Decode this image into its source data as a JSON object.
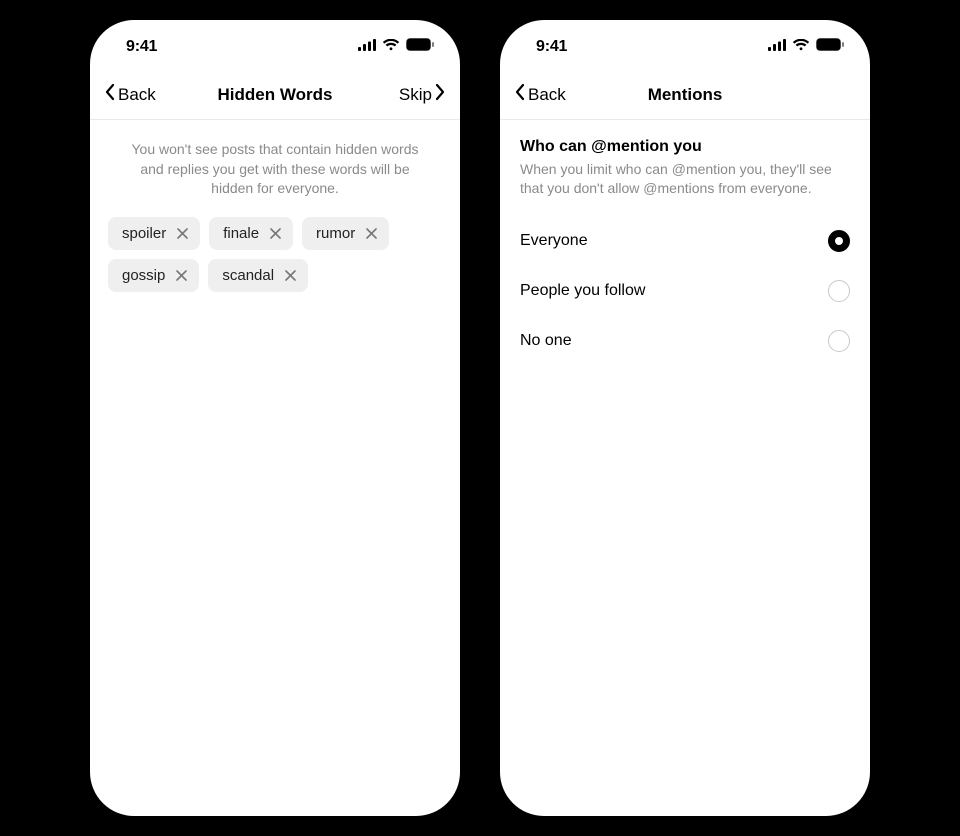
{
  "statusbar": {
    "time": "9:41"
  },
  "left": {
    "nav": {
      "back": "Back",
      "title": "Hidden Words",
      "skip": "Skip"
    },
    "description": "You won't see posts that contain hidden words and replies you get with these words will be hidden for everyone.",
    "chips": [
      "spoiler",
      "finale",
      "rumor",
      "gossip",
      "scandal"
    ]
  },
  "right": {
    "nav": {
      "back": "Back",
      "title": "Mentions"
    },
    "section": {
      "title": "Who can @mention you",
      "subtitle": "When you limit who can @mention you, they'll see that you don't allow @mentions from everyone."
    },
    "options": [
      {
        "label": "Everyone",
        "selected": true
      },
      {
        "label": "People you follow",
        "selected": false
      },
      {
        "label": "No one",
        "selected": false
      }
    ]
  }
}
